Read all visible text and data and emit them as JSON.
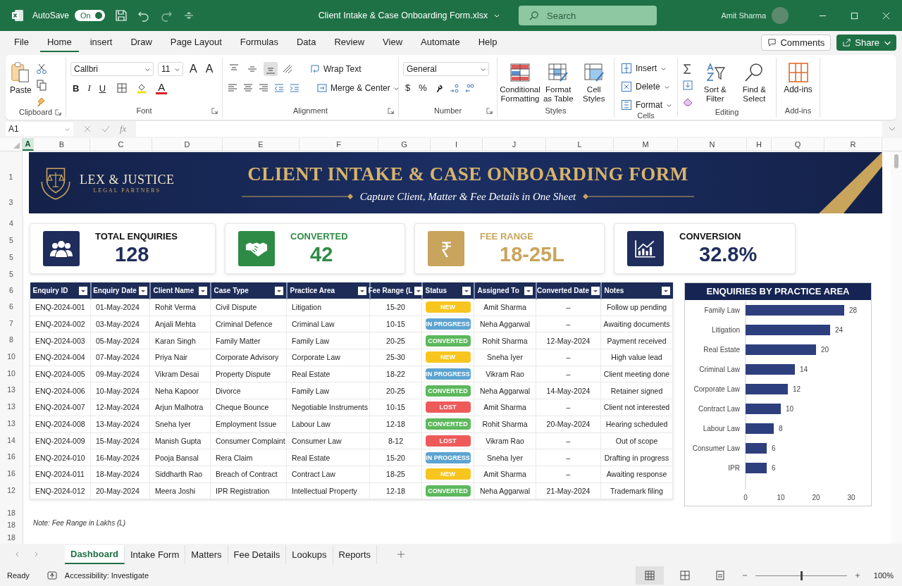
{
  "title_bar": {
    "autosave_label": "AutoSave",
    "autosave_toggle": {
      "label": "On",
      "on": true
    },
    "file_title": "Client Intake & Case Onboarding Form.xlsx",
    "search_placeholder": "Search",
    "user_name": "Amit Sharma"
  },
  "menu_tabs": [
    {
      "label": "File",
      "selected": false
    },
    {
      "label": "Home",
      "selected": true
    },
    {
      "label": "insert",
      "selected": false
    },
    {
      "label": "Draw",
      "selected": false
    },
    {
      "label": "Page Layout",
      "selected": false
    },
    {
      "label": "Formulas",
      "selected": false
    },
    {
      "label": "Data",
      "selected": false
    },
    {
      "label": "Review",
      "selected": false
    },
    {
      "label": "View",
      "selected": false
    },
    {
      "label": "Automate",
      "selected": false
    },
    {
      "label": "Help",
      "selected": false
    }
  ],
  "comments_button": "Comments",
  "share_button": "Share",
  "ribbon": {
    "clipboard": {
      "paste": "Paste",
      "group": "Clipboard"
    },
    "font": {
      "family": "Callbri",
      "size": "11",
      "grow": "A",
      "shrink": "A",
      "bold": "B",
      "italic": "I",
      "underline": "U",
      "font_color": "A",
      "group": "Font"
    },
    "alignment": {
      "vertical_align": [
        {
          "selected": false
        },
        {
          "selected": false
        },
        {
          "selected": true
        }
      ],
      "wrap": "Wrap Text",
      "merge": "Merge & Center",
      "group": "Alignment"
    },
    "number": {
      "format": "General",
      "currency": "$",
      "percent": "%",
      "group": "Number"
    },
    "styles": {
      "buttons": [
        {
          "label": "Conditional Formatting",
          "kind": "conditional"
        },
        {
          "label": "Format as Table",
          "kind": "table"
        },
        {
          "label": "Cell Styles",
          "kind": "cell"
        }
      ],
      "group": "Styles"
    },
    "cells": {
      "buttons": [
        {
          "label": "Insert",
          "kind": "insert"
        },
        {
          "label": "Delete",
          "kind": "delete"
        },
        {
          "label": "Format",
          "kind": "format"
        }
      ],
      "group": "Cells"
    },
    "editing": {
      "buttons": [
        {
          "label": "Sort & Filter",
          "kind": "sort"
        },
        {
          "label": "Find & Select",
          "kind": "find"
        }
      ],
      "group": "Editing"
    },
    "addins": {
      "button": "Add-ins",
      "group": "Add-ins"
    }
  },
  "formula_bar": {
    "name_box": "A1",
    "fx": "fx"
  },
  "column_headers": [
    {
      "label": "A",
      "selected": true
    },
    {
      "label": "B",
      "selected": false
    },
    {
      "label": "C",
      "selected": false
    },
    {
      "label": "D",
      "selected": false
    },
    {
      "label": "E",
      "selected": false
    },
    {
      "label": "F",
      "selected": false
    },
    {
      "label": "G",
      "selected": false
    },
    {
      "label": "I",
      "selected": false
    },
    {
      "label": "J",
      "selected": false
    },
    {
      "label": "L",
      "selected": false
    },
    {
      "label": "M",
      "selected": false
    },
    {
      "label": "N",
      "selected": false
    },
    {
      "label": "H",
      "selected": false
    },
    {
      "label": "Q",
      "selected": false
    },
    {
      "label": "R",
      "selected": false
    }
  ],
  "banner": {
    "row_labels": [
      "1",
      "3"
    ],
    "logo_name": "LEX & JUSTICE",
    "logo_tagline": "LEGAL PARTNERS",
    "title": "CLIENT INTAKE & CASE ONBOARDING FORM",
    "subtitle": "Capture Client, Matter & Fee Details in One Sheet"
  },
  "kpi_row_labels": [
    "4",
    "5",
    "5",
    "5"
  ],
  "kpis": [
    {
      "label": "TOTAL ENQUIRIES",
      "value": "128",
      "kind": "people",
      "color": "#1f2d5c",
      "accent_label": false
    },
    {
      "label": "CONVERTED",
      "value": "42",
      "kind": "handshake",
      "color": "#2e8b45",
      "accent_label": true
    },
    {
      "label": "FEE RANGE",
      "value": "18-25L",
      "kind": "rupee",
      "glyph": "₹",
      "color": "#c9a45c",
      "accent_label": true
    },
    {
      "label": "CONVERSION",
      "value": "32.8%",
      "kind": "chart",
      "color": "#1f2d5c",
      "accent_label": false
    }
  ],
  "table": {
    "header_row_label": "6",
    "columns": [
      "Enquiry ID",
      "Enquiry Date",
      "Client Name",
      "Case Type",
      "Practice Area",
      "Fee Range (L",
      "Status",
      "Assigned To",
      "Converted Date",
      "Notes"
    ],
    "rows": [
      {
        "row_label": "6",
        "cells": [
          "ENQ-2024-001",
          "01-May-2024",
          "Rohit Verma",
          "Civil Dispute",
          "Litigation",
          "15-20"
        ],
        "status": {
          "label": "NEW",
          "kind": "new"
        },
        "tail": [
          "Amit Sharma",
          "–",
          "Follow up pending"
        ]
      },
      {
        "row_label": "7",
        "cells": [
          "ENQ-2024-002",
          "03-May-2024",
          "Anjali Mehta",
          "Criminal Defence",
          "Criminal Law",
          "10-15"
        ],
        "status": {
          "label": "IN PROGRESS",
          "kind": "progress"
        },
        "tail": [
          "Neha Aggarwal",
          "–",
          "Awaiting documents"
        ]
      },
      {
        "row_label": "8",
        "cells": [
          "ENQ-2024-003",
          "05-May-2024",
          "Karan Singh",
          "Family Matter",
          "Family Law",
          "20-25"
        ],
        "status": {
          "label": "CONVERTED",
          "kind": "converted"
        },
        "tail": [
          "Rohit Sharma",
          "12-May-2024",
          "Payment received"
        ]
      },
      {
        "row_label": "10",
        "cells": [
          "ENQ-2024-004",
          "07-May-2024",
          "Priya Nair",
          "Corporate Advisory",
          "Corporate Law",
          "25-30"
        ],
        "status": {
          "label": "NEW",
          "kind": "new"
        },
        "tail": [
          "Sneha Iyer",
          "–",
          "High value lead"
        ]
      },
      {
        "row_label": "10",
        "cells": [
          "ENQ-2024-005",
          "09-May-2024",
          "Vikram Desai",
          "Property Dispute",
          "Real Estate",
          "18-22"
        ],
        "status": {
          "label": "IN PROGRESS",
          "kind": "progress"
        },
        "tail": [
          "Vikram Rao",
          "–",
          "Client meeting done"
        ]
      },
      {
        "row_label": "13",
        "cells": [
          "ENQ-2024-006",
          "10-May-2024",
          "Neha Kapoor",
          "Divorce",
          "Family Law",
          "20-25"
        ],
        "status": {
          "label": "CONVERTED",
          "kind": "converted"
        },
        "tail": [
          "Neha Aggarwal",
          "14-May-2024",
          "Retainer signed"
        ]
      },
      {
        "row_label": "13",
        "cells": [
          "ENQ-2024-007",
          "12-May-2024",
          "Arjun Malhotra",
          "Cheque Bounce",
          "Negotiable Instruments",
          "10-15"
        ],
        "status": {
          "label": "LOST",
          "kind": "lost"
        },
        "tail": [
          "Amit Sharma",
          "–",
          "Client not interested"
        ]
      },
      {
        "row_label": "13",
        "cells": [
          "ENQ-2024-008",
          "13-May-2024",
          "Sneha Iyer",
          "Employment Issue",
          "Labour Law",
          "12-18"
        ],
        "status": {
          "label": "CONVERTED",
          "kind": "converted"
        },
        "tail": [
          "Rohit Sharma",
          "20-May-2024",
          "Hearing scheduled"
        ]
      },
      {
        "row_label": "14",
        "cells": [
          "ENQ-2024-009",
          "15-May-2024",
          "Manish Gupta",
          "Consumer Complaint",
          "Consumer Law",
          "8-12"
        ],
        "status": {
          "label": "LOST",
          "kind": "lost"
        },
        "tail": [
          "Vikram Rao",
          "–",
          "Out of scope"
        ]
      },
      {
        "row_label": "16",
        "cells": [
          "ENQ-2024-010",
          "16-May-2024",
          "Pooja Bansal",
          "Rera Claim",
          "Real Estate",
          "15-20"
        ],
        "status": {
          "label": "IN PROGRESS",
          "kind": "progress"
        },
        "tail": [
          "Sneha Iyer",
          "–",
          "Drafting in progress"
        ]
      },
      {
        "row_label": "16",
        "cells": [
          "ENQ-2024-011",
          "18-May-2024",
          "Siddharth Rao",
          "Breach of Contract",
          "Contract Law",
          "18-25"
        ],
        "status": {
          "label": "NEW",
          "kind": "new"
        },
        "tail": [
          "Amit Sharma",
          "–",
          "Awaiting response"
        ]
      },
      {
        "row_label": "12",
        "cells": [
          "ENQ-2024-012",
          "20-May-2024",
          "Meera Joshi",
          "IPR Registration",
          "Intellectual Property",
          "12-18"
        ],
        "status": {
          "label": "CONVERTED",
          "kind": "converted"
        },
        "tail": [
          "Neha Aggarwal",
          "21-May-2024",
          "Trademark filing"
        ]
      }
    ]
  },
  "chart": {
    "chart_data": {
      "type": "bar",
      "orientation": "horizontal",
      "title": "ENQUIRIES BY PRACTICE AREA",
      "categories": [
        "Family Law",
        "Litigation",
        "Real Estate",
        "Criminal Law",
        "Corporate Law",
        "Contract Law",
        "Labour Law",
        "Consumer Law",
        "IPR"
      ],
      "series": [
        {
          "color": "#2e3f7e",
          "values": [
            28,
            24,
            20,
            14,
            12,
            10,
            8,
            6,
            6
          ]
        }
      ],
      "xlim": [
        0,
        30
      ],
      "xticks": [
        0,
        10,
        20,
        30
      ],
      "data_labels": true
    }
  },
  "note": "Note: Fee Range in Lakhs (L)",
  "bottom_row_labels": [
    "18",
    "18",
    "18"
  ],
  "sheet_tabs": [
    {
      "label": "Dashboard",
      "selected": true
    },
    {
      "label": "Intake Form",
      "selected": false
    },
    {
      "label": "Matters",
      "selected": false
    },
    {
      "label": "Fee Details",
      "selected": false
    },
    {
      "label": "Lookups",
      "selected": false
    },
    {
      "label": "Reports",
      "selected": false
    }
  ],
  "status_bar": {
    "ready": "Ready",
    "accessibility": "Accessibility: Investigate",
    "views": [
      {
        "kind": "normal",
        "selected": true
      },
      {
        "kind": "layout",
        "selected": false
      },
      {
        "kind": "break",
        "selected": false
      }
    ],
    "zoom_slider": {
      "level": 0.5
    },
    "zoom": "100%"
  }
}
